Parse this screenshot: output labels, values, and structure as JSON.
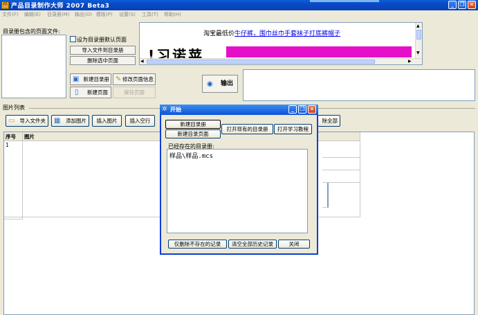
{
  "window": {
    "title": "产品目录制作大师 2007 Beta3",
    "app_icon_glyph": "🗃",
    "min_glyph": "_",
    "restore_glyph": "❐",
    "close_glyph": "✕"
  },
  "menu": [
    "文件(F)",
    "编辑(E)",
    "目录册(M)",
    "输出(O)",
    "模板(P)",
    "设置(S)",
    "工具(T)",
    "帮助(H)"
  ],
  "catalog_panel": {
    "pages_label": "目录册包含的页面文件:",
    "default_page_checkbox_label": "设为目录册默认页面",
    "import_file_button": "导入文件到目录册",
    "delete_selected_button": "删除选中页面",
    "new_catalog_button": "新建目录册",
    "edit_page_info_button": "修改页面信息",
    "new_page_button": "新建页面",
    "save_page_button": "保存页面",
    "output_button": "输出"
  },
  "ad": {
    "prefix": "淘宝最低价",
    "link_text": "牛仔裤，围巾丝巾手套袜子打底裤帽子",
    "banner_text": "!习诺苹"
  },
  "images_section": {
    "label": "图片列表",
    "toolbar": {
      "import_folder": "导入文件夹",
      "add_image": "添加图片",
      "insert_image": "插入图片",
      "insert_blank": "插入空行",
      "delete_all": "除全部"
    },
    "columns": [
      "序号",
      "图片"
    ],
    "rows": [
      {
        "index": "1"
      }
    ]
  },
  "dialog": {
    "title": "开始",
    "new_catalog_button": "新建目录册",
    "new_catalog_page_button": "新建目录页面",
    "open_existing_button": "打开现有的目录册",
    "open_tutorial_button": "打开学习教程",
    "existing_label": "已经存在的目录册:",
    "existing_items": [
      "样品\\样品.mcs"
    ],
    "delete_missing_button": "仅删除不存在的记录",
    "clear_history_button": "清空全部历史记录",
    "close_button": "关闭"
  },
  "colors": {
    "titlebar": "#0b49c5",
    "banner_magenta": "#e60fc9",
    "window_bg": "#ece9d8"
  }
}
